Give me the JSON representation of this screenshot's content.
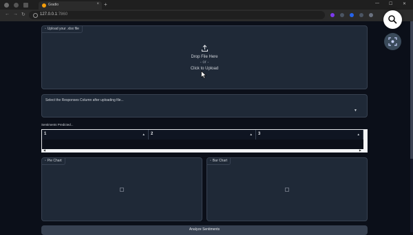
{
  "browser": {
    "tab_title": "Gradio",
    "url_host": "127.0.0.1",
    "url_port": ":7860"
  },
  "upload": {
    "label": "Upload your .xlsx file",
    "drop_line1": "Drop File Here",
    "drop_or": "- or -",
    "drop_line2": "Click to Upload"
  },
  "column_select": {
    "label": "Select the Responses Column after uploading file...",
    "value": ""
  },
  "sentiments": {
    "title": "Sentiments Predicted...",
    "headers": [
      "1",
      "2",
      "3"
    ]
  },
  "pie_chart": {
    "label": "Pie Chart"
  },
  "bar_chart": {
    "label": "Bar Chart"
  },
  "analyze_button": {
    "label": "Analyze Sentiments"
  },
  "colors": {
    "page_bg": "#0b0f19",
    "panel_bg": "#1f2937",
    "border": "#374151",
    "text": "#e5e7eb"
  }
}
